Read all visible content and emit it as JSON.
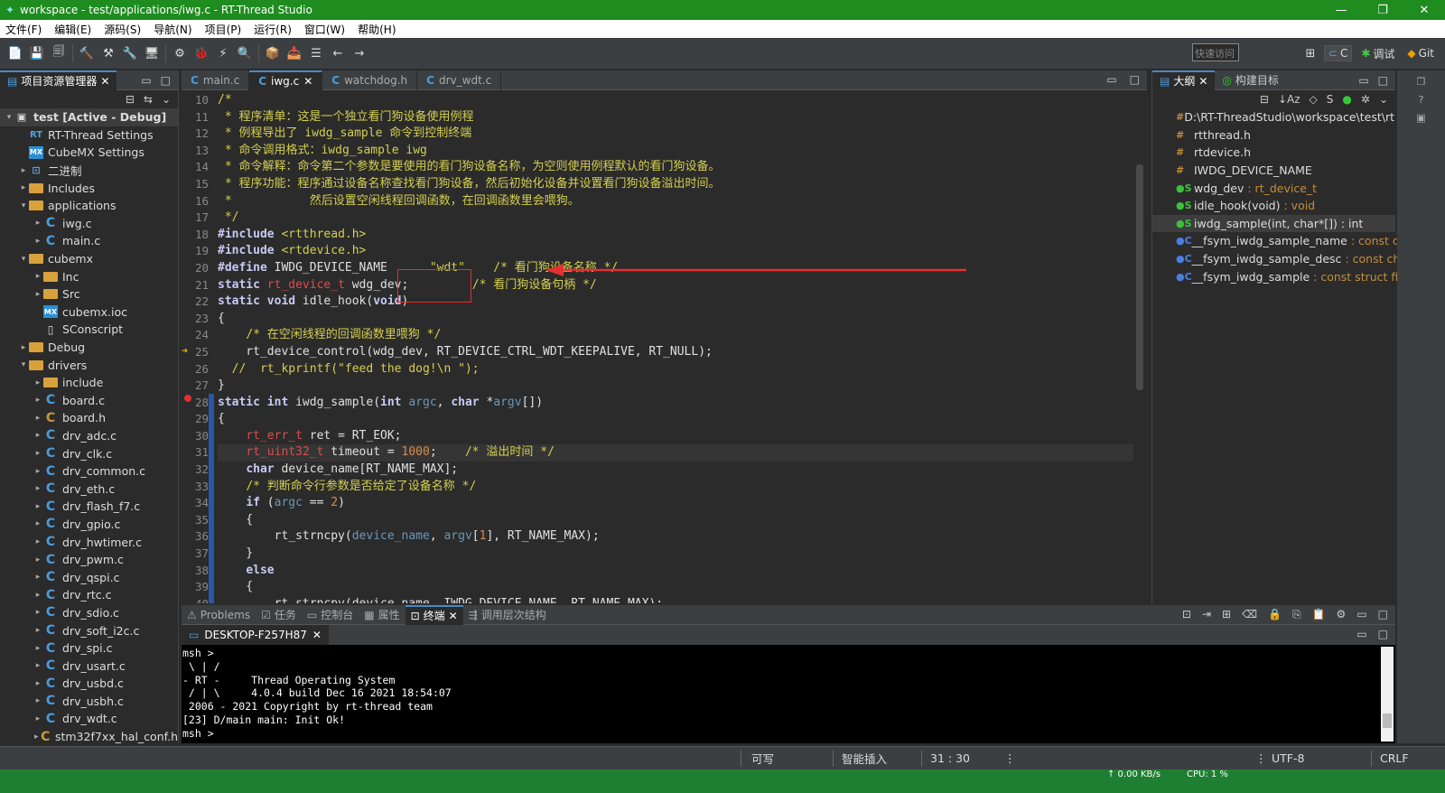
{
  "window": {
    "title": "workspace - test/applications/iwg.c - RT-Thread Studio",
    "controls": [
      "—",
      "❐",
      "✕"
    ]
  },
  "menu": [
    "文件(F)",
    "编辑(E)",
    "源码(S)",
    "导航(N)",
    "项目(P)",
    "运行(R)",
    "窗口(W)",
    "帮助(H)"
  ],
  "toolbar": {
    "quick_access": "快速访问",
    "perspectives": [
      "C",
      "调试",
      "Git"
    ]
  },
  "explorer": {
    "tab": "项目资源管理器",
    "items": [
      {
        "label": "test  [Active - Debug]",
        "icon": "project",
        "arrow": "▾",
        "indent": 0,
        "bold": true
      },
      {
        "label": "RT-Thread Settings",
        "icon": "rt",
        "arrow": "",
        "indent": 1
      },
      {
        "label": "CubeMX Settings",
        "icon": "mx",
        "arrow": "",
        "indent": 1
      },
      {
        "label": "二进制",
        "icon": "bin",
        "arrow": "▸",
        "indent": 1
      },
      {
        "label": "Includes",
        "icon": "fold",
        "arrow": "▸",
        "indent": 1
      },
      {
        "label": "applications",
        "icon": "fold",
        "arrow": "▾",
        "indent": 1
      },
      {
        "label": "iwg.c",
        "icon": "c",
        "arrow": "▸",
        "indent": 2
      },
      {
        "label": "main.c",
        "icon": "c",
        "arrow": "▸",
        "indent": 2
      },
      {
        "label": "cubemx",
        "icon": "fold",
        "arrow": "▾",
        "indent": 1
      },
      {
        "label": "Inc",
        "icon": "fold",
        "arrow": "▸",
        "indent": 2
      },
      {
        "label": "Src",
        "icon": "fold",
        "arrow": "▸",
        "indent": 2
      },
      {
        "label": "cubemx.ioc",
        "icon": "mx",
        "arrow": "",
        "indent": 2
      },
      {
        "label": "SConscript",
        "icon": "file",
        "arrow": "",
        "indent": 2
      },
      {
        "label": "Debug",
        "icon": "fold",
        "arrow": "▸",
        "indent": 1
      },
      {
        "label": "drivers",
        "icon": "fold",
        "arrow": "▾",
        "indent": 1
      },
      {
        "label": "include",
        "icon": "fold",
        "arrow": "▸",
        "indent": 2
      },
      {
        "label": "board.c",
        "icon": "c",
        "arrow": "▸",
        "indent": 2
      },
      {
        "label": "board.h",
        "icon": "h",
        "arrow": "▸",
        "indent": 2
      },
      {
        "label": "drv_adc.c",
        "icon": "c",
        "arrow": "▸",
        "indent": 2
      },
      {
        "label": "drv_clk.c",
        "icon": "c",
        "arrow": "▸",
        "indent": 2
      },
      {
        "label": "drv_common.c",
        "icon": "c",
        "arrow": "▸",
        "indent": 2
      },
      {
        "label": "drv_eth.c",
        "icon": "c",
        "arrow": "▸",
        "indent": 2
      },
      {
        "label": "drv_flash_f7.c",
        "icon": "c",
        "arrow": "▸",
        "indent": 2
      },
      {
        "label": "drv_gpio.c",
        "icon": "c",
        "arrow": "▸",
        "indent": 2
      },
      {
        "label": "drv_hwtimer.c",
        "icon": "c",
        "arrow": "▸",
        "indent": 2
      },
      {
        "label": "drv_pwm.c",
        "icon": "c",
        "arrow": "▸",
        "indent": 2
      },
      {
        "label": "drv_qspi.c",
        "icon": "c",
        "arrow": "▸",
        "indent": 2
      },
      {
        "label": "drv_rtc.c",
        "icon": "c",
        "arrow": "▸",
        "indent": 2
      },
      {
        "label": "drv_sdio.c",
        "icon": "c",
        "arrow": "▸",
        "indent": 2
      },
      {
        "label": "drv_soft_i2c.c",
        "icon": "c",
        "arrow": "▸",
        "indent": 2
      },
      {
        "label": "drv_spi.c",
        "icon": "c",
        "arrow": "▸",
        "indent": 2
      },
      {
        "label": "drv_usart.c",
        "icon": "c",
        "arrow": "▸",
        "indent": 2
      },
      {
        "label": "drv_usbd.c",
        "icon": "c",
        "arrow": "▸",
        "indent": 2
      },
      {
        "label": "drv_usbh.c",
        "icon": "c",
        "arrow": "▸",
        "indent": 2
      },
      {
        "label": "drv_wdt.c",
        "icon": "c",
        "arrow": "▸",
        "indent": 2
      },
      {
        "label": "stm32f7xx_hal_conf.h",
        "icon": "h",
        "arrow": "▸",
        "indent": 2
      }
    ]
  },
  "editor": {
    "tabs": [
      {
        "label": "main.c",
        "active": false,
        "icon": "C"
      },
      {
        "label": "iwg.c",
        "active": true,
        "icon": "C"
      },
      {
        "label": "watchdog.h",
        "active": false,
        "icon": "C"
      },
      {
        "label": "drv_wdt.c",
        "active": false,
        "icon": "C"
      }
    ],
    "line_numbers": [
      "10",
      "11",
      "12",
      "13",
      "14",
      "15",
      "16",
      "17",
      "18",
      "19",
      "20",
      "21",
      "22",
      "23",
      "24",
      "25",
      "26",
      "27",
      "28",
      "29",
      "30",
      "31",
      "32",
      "33",
      "34",
      "35",
      "36",
      "37",
      "38",
      "39",
      "40"
    ],
    "highlighted_line": "31"
  },
  "outline": {
    "tabs": [
      "大纲",
      "构建目标"
    ],
    "items": [
      {
        "icon": "#",
        "name": "D:\\RT-ThreadStudio\\workspace\\test\\rt",
        "type": ""
      },
      {
        "icon": "#",
        "name": "rtthread.h",
        "type": ""
      },
      {
        "icon": "#",
        "name": "rtdevice.h",
        "type": ""
      },
      {
        "icon": "#",
        "name": "IWDG_DEVICE_NAME",
        "type": ""
      },
      {
        "icon": "●S",
        "name": "wdg_dev",
        "type": " : rt_device_t"
      },
      {
        "icon": "●S",
        "name": "idle_hook(void)",
        "type": " : void"
      },
      {
        "icon": "●S",
        "name": "iwdg_sample(int, char*[]) : int",
        "type": ""
      },
      {
        "icon": "●C",
        "name": "__fsym_iwdg_sample_name",
        "type": " : const cha"
      },
      {
        "icon": "●C",
        "name": "__fsym_iwdg_sample_desc",
        "type": " : const char"
      },
      {
        "icon": "●C",
        "name": "__fsym_iwdg_sample",
        "type": " : const struct finsl"
      }
    ]
  },
  "bottom": {
    "tabs": [
      "Problems",
      "任务",
      "控制台",
      "属性",
      "终端",
      "调用层次结构"
    ],
    "active": "终端",
    "terminal_tab": "DESKTOP-F257H87",
    "console": "msh >\n \\ | /\n- RT -     Thread Operating System\n / | \\     4.0.4 build Dec 16 2021 18:54:07\n 2006 - 2021 Copyright by rt-thread team\n[23] D/main main: Init Ok!\nmsh >"
  },
  "status": {
    "writable": "可写",
    "insert": "智能插入",
    "position": "31 : 30",
    "encoding": "UTF-8",
    "eol": "CRLF"
  },
  "taskbar": {
    "net": "↑ 0.00 KB/s",
    "cpu": "CPU: 1 %"
  }
}
